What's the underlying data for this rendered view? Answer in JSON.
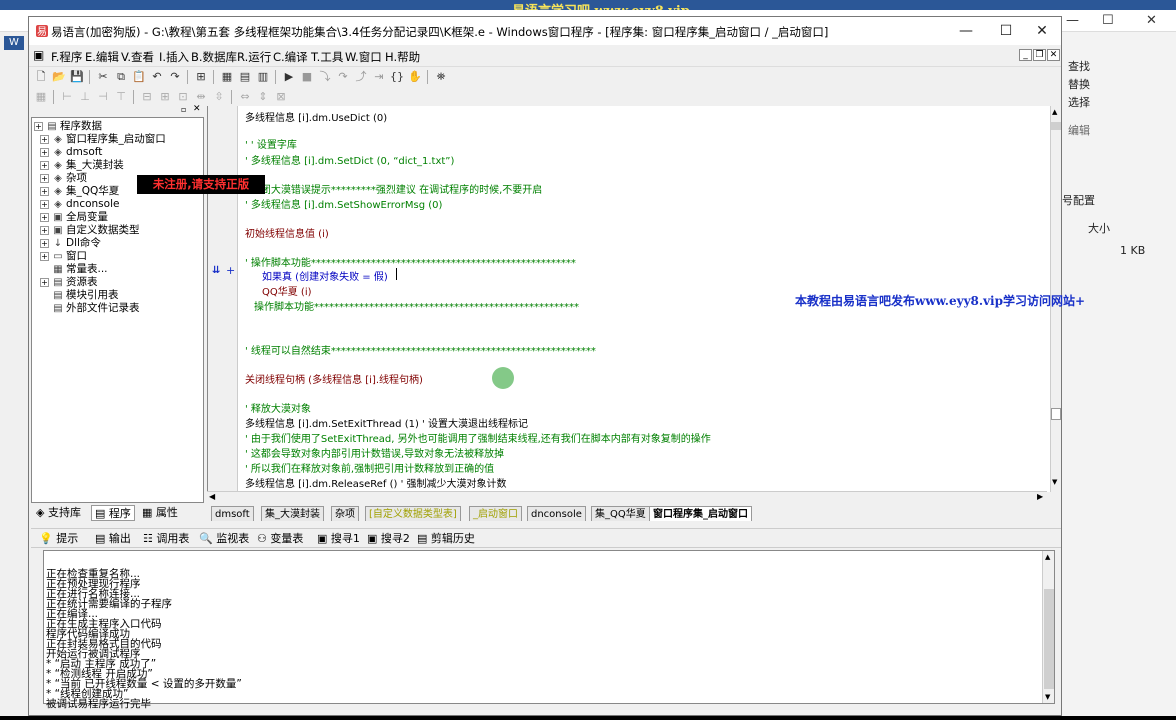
{
  "watermark_top": "易语言学习吧 www.eyy8.vip",
  "window": {
    "title": "易语言(加密狗版) - G:\\教程\\第五套 多线程框架功能集合\\3.4任务分配记录四\\K框架.e - Windows窗口程序 - [程序集: 窗口程序集_启动窗口 / _启动窗口]"
  },
  "menu": [
    "F.程序",
    "E.编辑",
    "V.查看",
    "I.插入",
    "B.数据库",
    "R.运行",
    "C.编译",
    "T.工具",
    "W.窗口",
    "H.帮助"
  ],
  "tree": {
    "items": [
      {
        "label": "程序数据",
        "level": 0
      },
      {
        "label": "窗口程序集_启动窗口",
        "level": 1
      },
      {
        "label": "dmsoft",
        "level": 1
      },
      {
        "label": "集_大漠封装",
        "level": 1
      },
      {
        "label": "杂项",
        "level": 1
      },
      {
        "label": "集_QQ华夏",
        "level": 1
      },
      {
        "label": "dnconsole",
        "level": 1
      },
      {
        "label": "全局变量",
        "level": 1
      },
      {
        "label": "自定义数据类型",
        "level": 1
      },
      {
        "label": "Dll命令",
        "level": 1
      },
      {
        "label": "窗口",
        "level": 1
      },
      {
        "label": "常量表...",
        "level": 1
      },
      {
        "label": "资源表",
        "level": 1
      },
      {
        "label": "模块引用表",
        "level": 1
      },
      {
        "label": "外部文件记录表",
        "level": 1
      }
    ],
    "tabs": [
      "支持库",
      "程序",
      "属性"
    ]
  },
  "code": {
    "lines": [
      {
        "text": "多线程信息 [i].dm.UseDict (0)",
        "color": "black"
      },
      {
        "text": "' ' 设置字库",
        "color": "green"
      },
      {
        "text": "' 多线程信息 [i].dm.SetDict (0, “dict_1.txt”)",
        "color": "green"
      },
      {
        "text": "' 关闭大漠错误提示*********强烈建议   在调试程序的时候,不要开启",
        "color": "green"
      },
      {
        "text": "' 多线程信息 [i].dm.SetShowErrorMsg (0)",
        "color": "green"
      },
      {
        "text": "初始线程信息值 (i)",
        "color": "darkred"
      },
      {
        "text": "' 操作脚本功能*****************************************************",
        "color": "green"
      },
      {
        "text": "如果真 (创建对象失败 = 假)",
        "color": "blue"
      },
      {
        "text": "QQ华夏 (i)",
        "color": "darkred"
      },
      {
        "text": "操作脚本功能*****************************************************",
        "color": "green"
      },
      {
        "text": "' 线程可以自然结束*****************************************************",
        "color": "green"
      },
      {
        "text": "关闭线程句柄 (多线程信息 [i].线程句柄)",
        "color": "darkred"
      },
      {
        "text": "' 释放大漠对象",
        "color": "green"
      },
      {
        "text": "多线程信息 [i].dm.SetExitThread (1)  ' 设置大漠退出线程标记",
        "color": "black"
      },
      {
        "text": "' 由于我们使用了SetExitThread, 另外也可能调用了强制结束线程,还有我们在脚本内部有对象复制的操作",
        "color": "green"
      },
      {
        "text": "' 这都会导致对象内部引用计数错误,导致对象无法被释放掉",
        "color": "green"
      },
      {
        "text": "' 所以我们在释放对象前,强制把引用计数释放到正确的值",
        "color": "green"
      },
      {
        "text": "多线程信息 [i].dm.ReleaseRef ()  ' 强制减少大漠对象计数",
        "color": "black"
      }
    ]
  },
  "doc_tabs": [
    "dmsoft",
    "集_大漠封装",
    "杂项",
    "[自定义数据类型表]",
    "_启动窗口",
    "dnconsole",
    "集_QQ华夏",
    "窗口程序集_启动窗口"
  ],
  "output_tabs": [
    "提示",
    "输出",
    "调用表",
    "监视表",
    "变量表",
    "搜寻1",
    "搜寻2",
    "剪辑历史"
  ],
  "output_lines": [
    "正在检查重复名称...",
    "正在预处理现行程序",
    "正在进行名称连接...",
    "正在统计需要编译的子程序",
    "正在编译...",
    "正在生成主程序入口代码",
    "程序代码编译成功",
    "正在封装易格式目的代码",
    "开始运行被调试程序",
    "* “启动   主程序   成功了”",
    "* “检测线程   开启成功”",
    "* “当前 已开线程数量   <   设置的多开数量”",
    "* “线程创建成功”",
    "被调试易程序运行完毕"
  ],
  "overlays": {
    "unregistered": "未注册,请支持正版",
    "ad": "本教程由易语言吧发布www.eyy8.vip学习访问网站+"
  },
  "background_app": {
    "right_labels": [
      "查找",
      "替换",
      "选择",
      "编辑",
      "号配置",
      "大小",
      "1 KB"
    ]
  }
}
